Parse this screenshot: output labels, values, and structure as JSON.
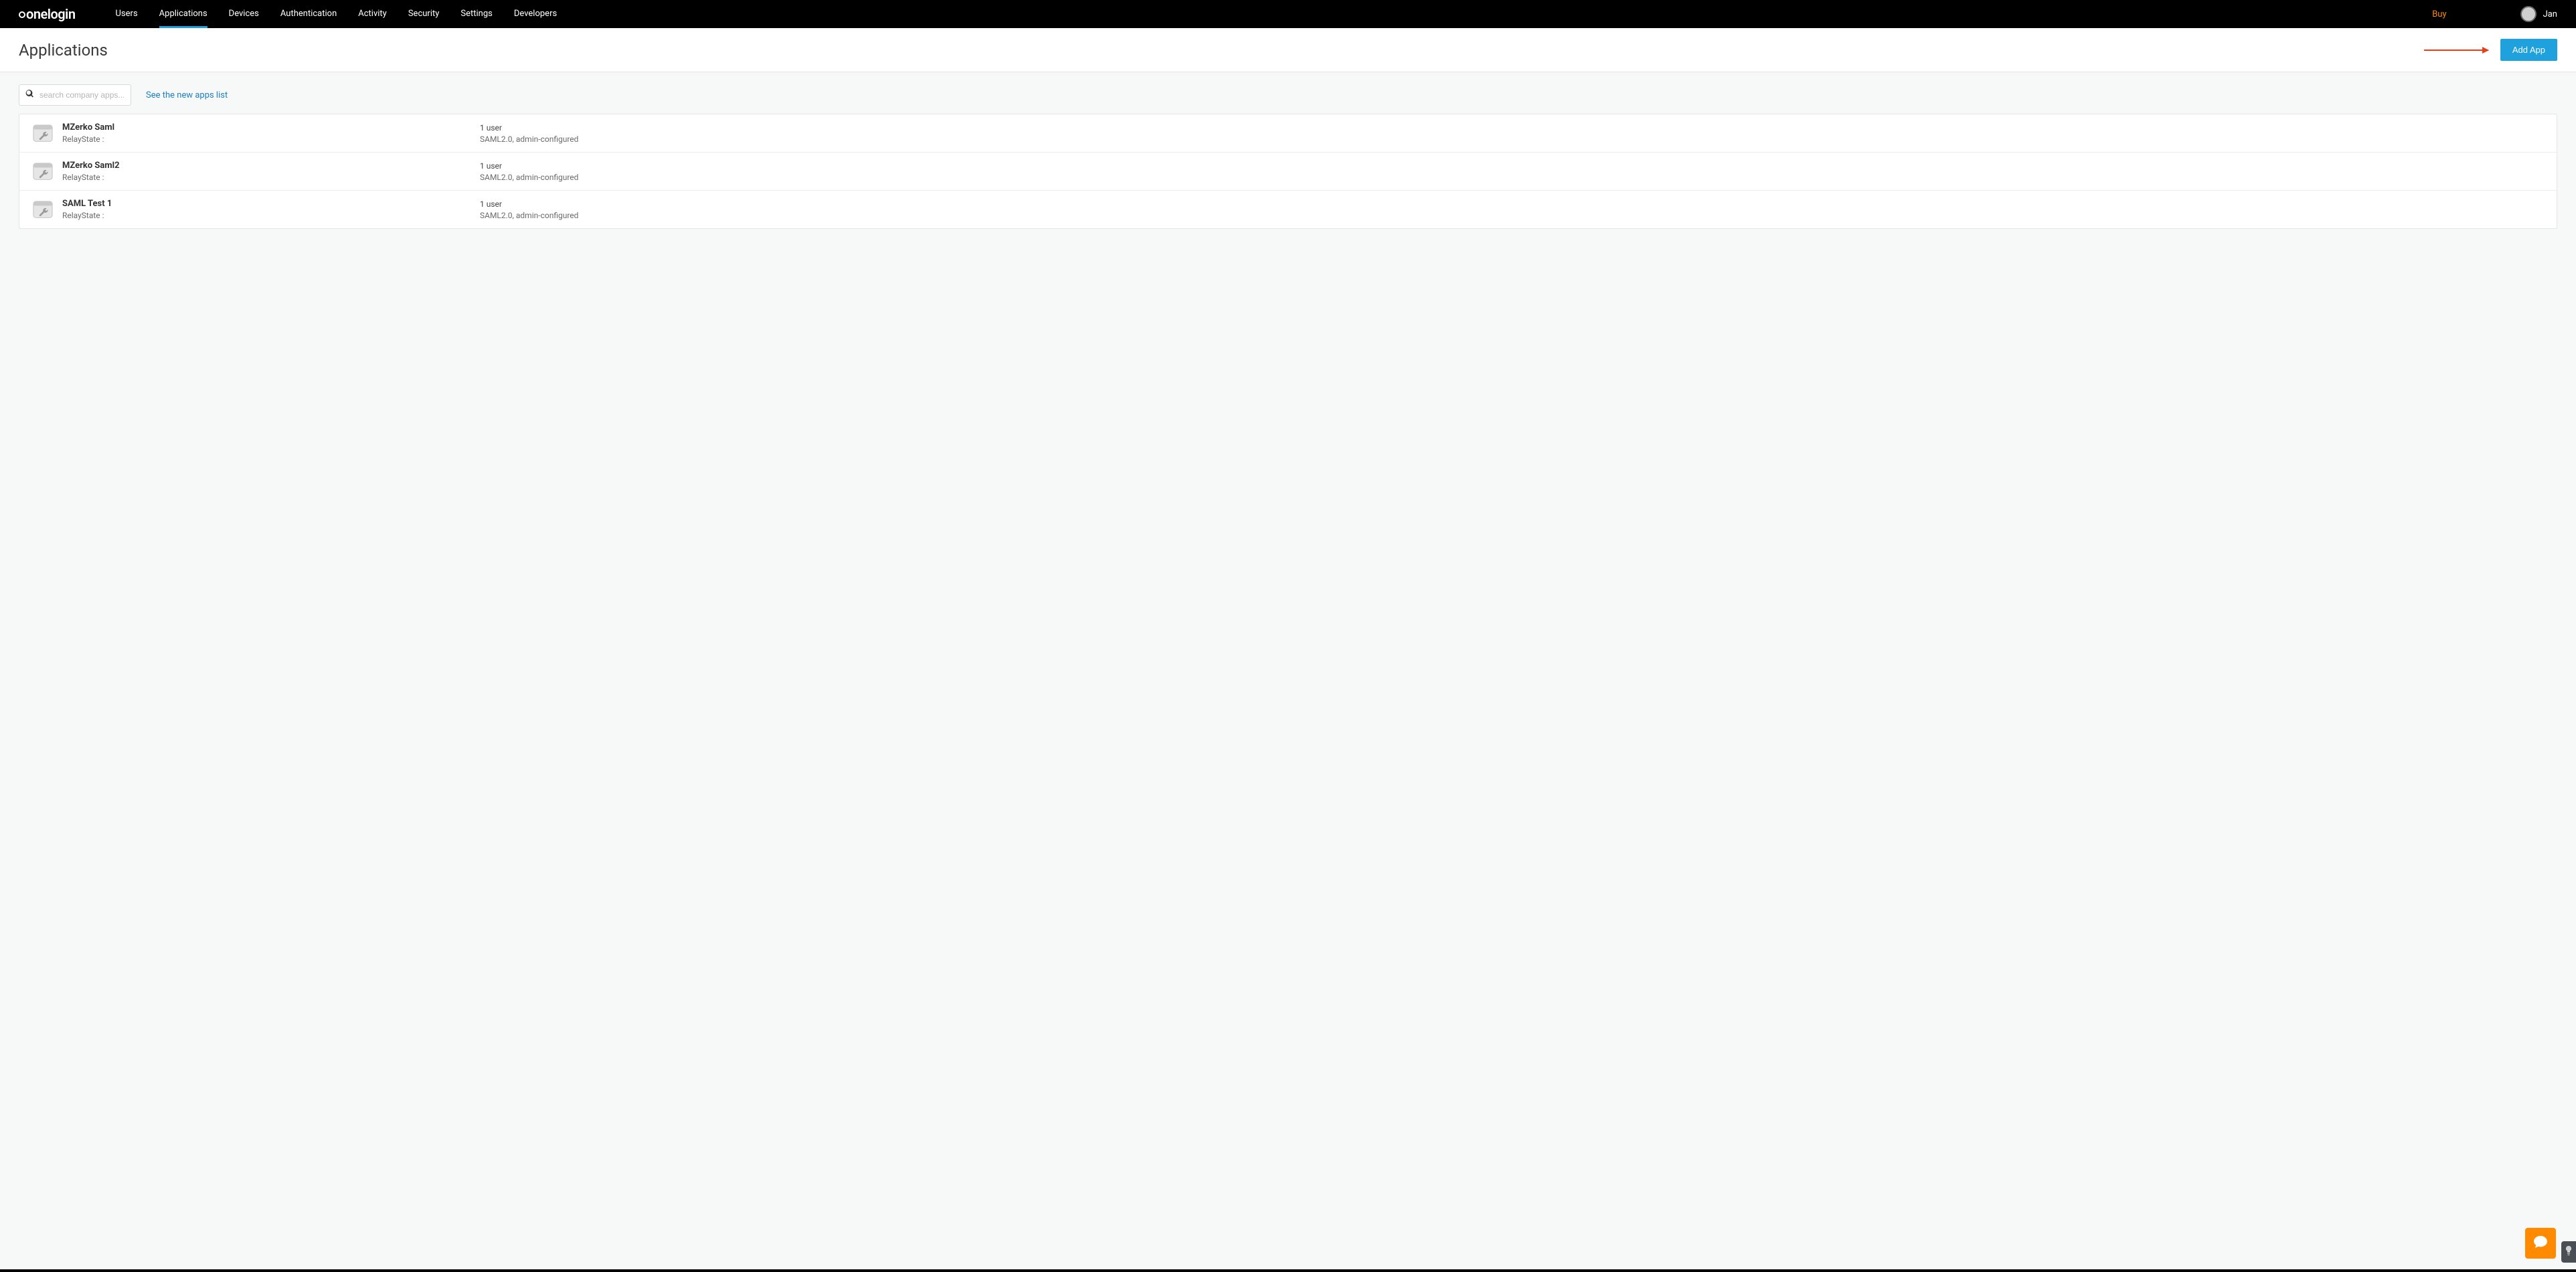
{
  "brand": "onelogin",
  "nav": {
    "items": [
      {
        "label": "Users",
        "active": false
      },
      {
        "label": "Applications",
        "active": true
      },
      {
        "label": "Devices",
        "active": false
      },
      {
        "label": "Authentication",
        "active": false
      },
      {
        "label": "Activity",
        "active": false
      },
      {
        "label": "Security",
        "active": false
      },
      {
        "label": "Settings",
        "active": false
      },
      {
        "label": "Developers",
        "active": false
      }
    ],
    "buy_label": "Buy",
    "user_name": "Jan"
  },
  "page": {
    "title": "Applications",
    "add_button": "Add App"
  },
  "toolbar": {
    "search_placeholder": "search company apps...",
    "new_apps_link": "See the new apps list"
  },
  "apps": [
    {
      "name": "MZerko Saml",
      "relay": "RelayState :",
      "users": "1 user",
      "detail": "SAML2.0, admin-configured"
    },
    {
      "name": "MZerko Saml2",
      "relay": "RelayState :",
      "users": "1 user",
      "detail": "SAML2.0, admin-configured"
    },
    {
      "name": "SAML Test 1",
      "relay": "RelayState :",
      "users": "1 user",
      "detail": "SAML2.0, admin-configured"
    }
  ]
}
